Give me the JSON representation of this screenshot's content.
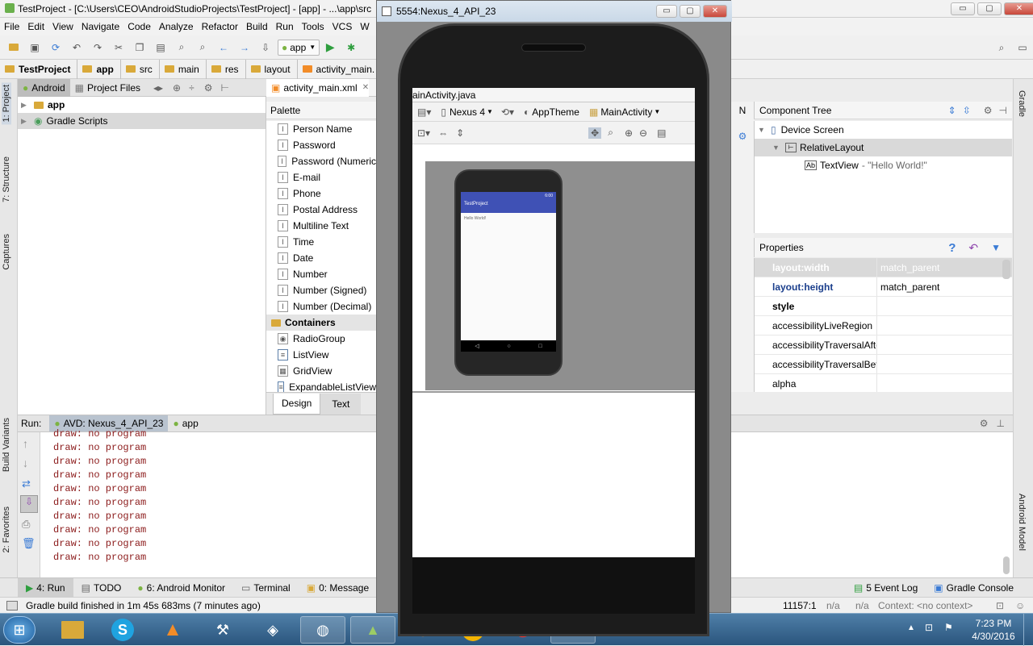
{
  "window": {
    "title": "TestProject - [C:\\Users\\CEO\\AndroidStudioProjects\\TestProject] - [app] - ...\\app\\src",
    "min": "▭",
    "max": "▢",
    "close": "✕"
  },
  "menu": [
    "File",
    "Edit",
    "View",
    "Navigate",
    "Code",
    "Analyze",
    "Refactor",
    "Build",
    "Run",
    "Tools",
    "VCS",
    "W"
  ],
  "toolbar": {
    "run_config": "app"
  },
  "breadcrumb": [
    "TestProject",
    "app",
    "src",
    "main",
    "res",
    "layout",
    "activity_main."
  ],
  "left_strip": {
    "project": "1: Project",
    "structure": "7: Structure",
    "captures": "Captures",
    "build_variants": "Build Variants",
    "favorites": "2: Favorites"
  },
  "right_strip": {
    "gradle": "Gradle",
    "android_model": "Android Model"
  },
  "project_panel": {
    "tabs": [
      "Android",
      "Project Files"
    ],
    "tree": [
      "app",
      "Gradle Scripts"
    ]
  },
  "editor_tabs": {
    "active": "activity_main.xml",
    "other": "ainActivity.java"
  },
  "palette": {
    "title": "Palette",
    "items": [
      "Person Name",
      "Password",
      "Password (Numeric",
      "E-mail",
      "Phone",
      "Postal Address",
      "Multiline Text",
      "Time",
      "Date",
      "Number",
      "Number (Signed)",
      "Number (Decimal)"
    ],
    "section": "Containers",
    "containers": [
      "RadioGroup",
      "ListView",
      "GridView",
      "ExpandableListView"
    ]
  },
  "design_toolbar": {
    "device": "Nexus 4",
    "theme": "AppTheme",
    "activity": "MainActivity",
    "api": "N"
  },
  "design_tabs": [
    "Design",
    "Text"
  ],
  "preview": {
    "app_title": "TestProject",
    "text": "Hello World!",
    "time": "6:00"
  },
  "component_tree": {
    "title": "Component Tree",
    "nodes": [
      "Device Screen",
      "RelativeLayout",
      "TextView"
    ],
    "textview_value": "- \"Hello World!\""
  },
  "properties": {
    "title": "Properties",
    "rows": [
      {
        "name": "layout:width",
        "value": "match_parent"
      },
      {
        "name": "layout:height",
        "value": "match_parent"
      },
      {
        "name": "style",
        "value": ""
      },
      {
        "name": "accessibilityLiveRegion",
        "value": ""
      },
      {
        "name": "accessibilityTraversalAfte",
        "value": ""
      },
      {
        "name": "accessibilityTraversalBefo",
        "value": ""
      },
      {
        "name": "alpha",
        "value": ""
      }
    ]
  },
  "run_panel": {
    "label": "Run:",
    "tabs": [
      "AVD: Nexus_4_API_23",
      "app"
    ],
    "lines": [
      "draw: no program",
      "draw: no program",
      "draw: no program",
      "draw: no program",
      "draw: no program",
      "draw: no program",
      "draw: no program",
      "draw: no program",
      "draw: no program",
      "draw: no program"
    ]
  },
  "bottom_tabs": {
    "run": "4: Run",
    "todo": "TODO",
    "monitor": "6: Android Monitor",
    "terminal": "Terminal",
    "messages": "0: Message",
    "event_log": "5 Event Log",
    "gradle_console": "Gradle Console"
  },
  "status": {
    "message": "Gradle build finished in 1m 45s 683ms (7 minutes ago)",
    "position": "11157:1",
    "na1": "n/a",
    "na2": "n/a",
    "context": "Context: <no context>"
  },
  "emulator": {
    "title": "5554:Nexus_4_API_23"
  },
  "taskbar": {
    "time": "7:23 PM",
    "date": "4/30/2016"
  },
  "colors": {
    "accent": "#3f51b5",
    "console_text": "#8b1a1a",
    "selection": "#d9d9d9"
  }
}
